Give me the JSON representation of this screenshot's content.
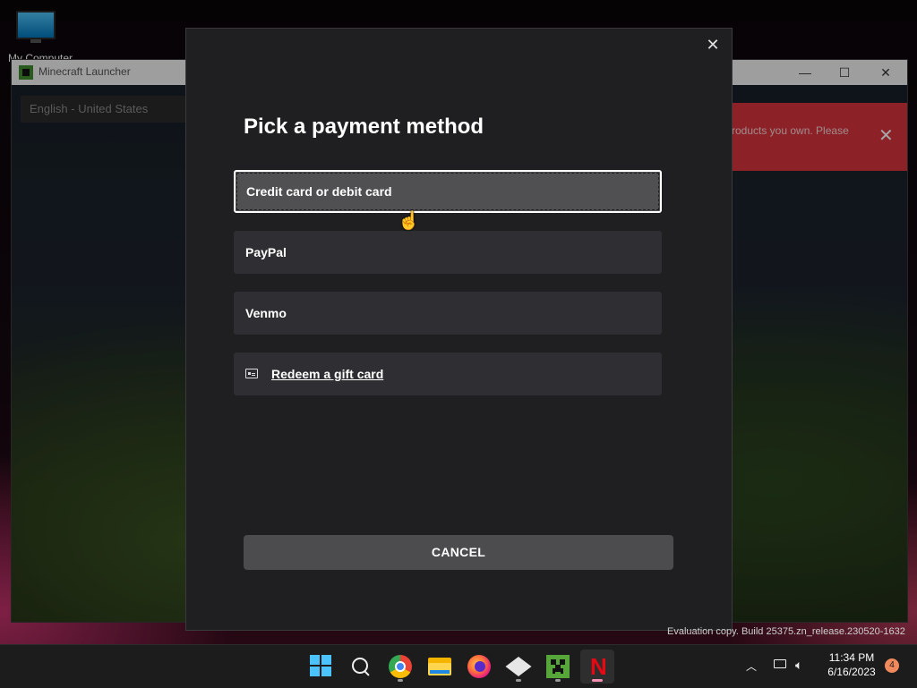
{
  "desktop": {
    "icon_label": "My Computer"
  },
  "launcher": {
    "title": "Minecraft Launcher",
    "language": "English - United States",
    "error_text": "roducts you own. Please",
    "controls": {
      "minimize": "—",
      "maximize": "☐",
      "close": "✕"
    }
  },
  "modal": {
    "title": "Pick a payment method",
    "close_glyph": "✕",
    "options": [
      {
        "label": "Credit card or debit card",
        "selected": true
      },
      {
        "label": "PayPal",
        "selected": false
      },
      {
        "label": "Venmo",
        "selected": false
      }
    ],
    "gift_card_label": "Redeem a gift card",
    "cancel_label": "CANCEL"
  },
  "watermark": {
    "line1": "Evaluation copy. Build 25375.zn_release.230520-1632"
  },
  "taskbar": {
    "apps": [
      "start",
      "search",
      "chrome",
      "file-explorer",
      "firefox",
      "package",
      "minecraft",
      "netflix"
    ],
    "time": "11:34 PM",
    "date": "6/16/2023",
    "notification_count": "4",
    "accent": "#4cc2ff"
  },
  "colors": {
    "error_banner": "#d8353e",
    "modal_bg": "#1f1f21",
    "option_bg": "#2f2f33",
    "selected_bg": "#505053"
  }
}
